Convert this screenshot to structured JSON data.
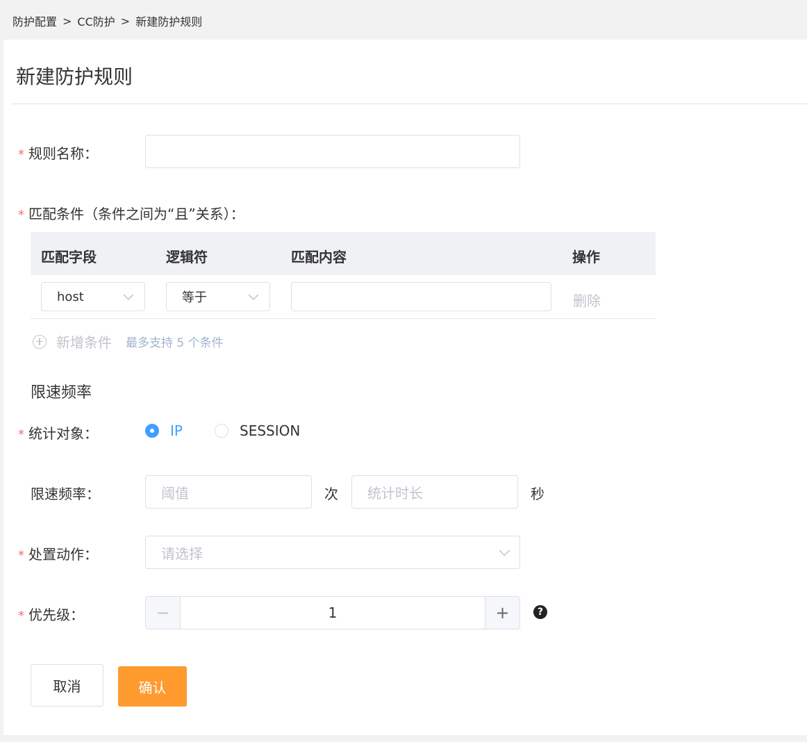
{
  "breadcrumb": {
    "items": [
      "防护配置",
      "CC防护",
      "新建防护规则"
    ],
    "separator": ">"
  },
  "page": {
    "title": "新建防护规则"
  },
  "form": {
    "rule_name": {
      "label": "规则名称：",
      "value": ""
    },
    "match": {
      "label": "匹配条件（条件之间为“且”关系）：",
      "columns": [
        "匹配字段",
        "逻辑符",
        "匹配内容",
        "操作"
      ],
      "rows": [
        {
          "field": "host",
          "operator": "等于",
          "content": "",
          "action": "删除"
        }
      ],
      "add_label": "新增条件",
      "add_hint": "最多支持 5 个条件"
    },
    "rate_section_title": "限速频率",
    "stat_target": {
      "label": "统计对象：",
      "options": [
        "IP",
        "SESSION"
      ],
      "selected": "IP"
    },
    "rate_limit": {
      "label": "限速频率：",
      "threshold_placeholder": "阈值",
      "times_unit": "次",
      "duration_placeholder": "统计时长",
      "seconds_unit": "秒"
    },
    "action": {
      "label": "处置动作：",
      "placeholder": "请选择"
    },
    "priority": {
      "label": "优先级：",
      "value": "1",
      "minus": "−",
      "plus": "+",
      "help": "?"
    },
    "required_mark": "*"
  },
  "buttons": {
    "cancel": "取消",
    "confirm": "确认"
  },
  "colors": {
    "accent": "#409eff",
    "confirm": "#ff9a2e",
    "required": "#f56c6c"
  }
}
